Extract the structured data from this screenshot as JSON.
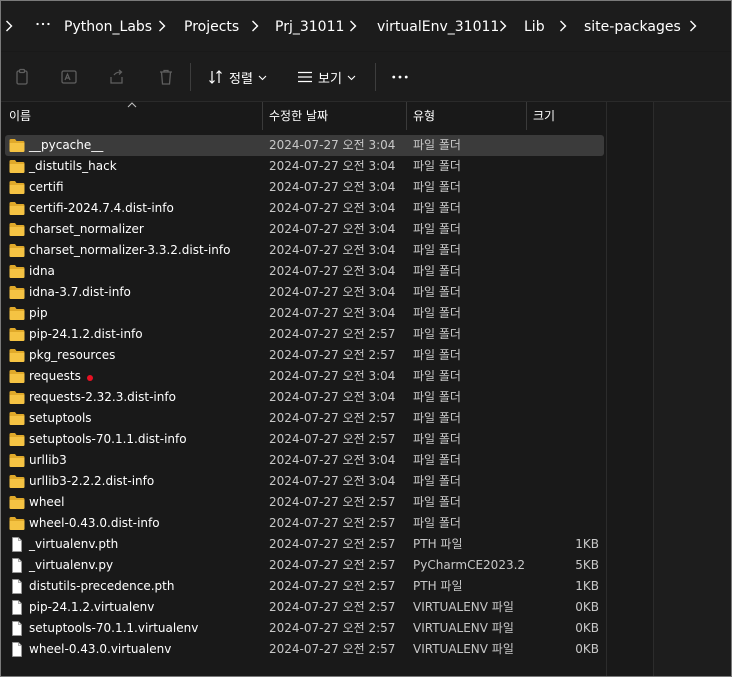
{
  "colors": {
    "folder": "#f5c343",
    "folder_dark": "#e0a92a",
    "selected_row": "#3b3b3b",
    "marker": "#e81123"
  },
  "breadcrumb": {
    "more_icon": "ellipsis-icon",
    "items": [
      "Python_Labs",
      "Projects",
      "Prj_31011",
      "virtualEnv_31011",
      "Lib",
      "site-packages"
    ]
  },
  "toolbar": {
    "icons": [
      "copy-icon",
      "rename-icon",
      "share-icon",
      "delete-icon"
    ],
    "sort_label": "정렬",
    "view_label": "보기",
    "more_icon": "more-icon"
  },
  "columns": {
    "name": "이름",
    "modified": "수정한 날짜",
    "type": "유형",
    "size": "크기"
  },
  "files": [
    {
      "name": "__pycache__",
      "date": "2024-07-27 오전 3:04",
      "type": "파일 폴더",
      "size": "",
      "kind": "folder",
      "selected": true
    },
    {
      "name": "_distutils_hack",
      "date": "2024-07-27 오전 3:04",
      "type": "파일 폴더",
      "size": "",
      "kind": "folder"
    },
    {
      "name": "certifi",
      "date": "2024-07-27 오전 3:04",
      "type": "파일 폴더",
      "size": "",
      "kind": "folder"
    },
    {
      "name": "certifi-2024.7.4.dist-info",
      "date": "2024-07-27 오전 3:04",
      "type": "파일 폴더",
      "size": "",
      "kind": "folder"
    },
    {
      "name": "charset_normalizer",
      "date": "2024-07-27 오전 3:04",
      "type": "파일 폴더",
      "size": "",
      "kind": "folder"
    },
    {
      "name": "charset_normalizer-3.3.2.dist-info",
      "date": "2024-07-27 오전 3:04",
      "type": "파일 폴더",
      "size": "",
      "kind": "folder"
    },
    {
      "name": "idna",
      "date": "2024-07-27 오전 3:04",
      "type": "파일 폴더",
      "size": "",
      "kind": "folder"
    },
    {
      "name": "idna-3.7.dist-info",
      "date": "2024-07-27 오전 3:04",
      "type": "파일 폴더",
      "size": "",
      "kind": "folder"
    },
    {
      "name": "pip",
      "date": "2024-07-27 오전 3:04",
      "type": "파일 폴더",
      "size": "",
      "kind": "folder"
    },
    {
      "name": "pip-24.1.2.dist-info",
      "date": "2024-07-27 오전 2:57",
      "type": "파일 폴더",
      "size": "",
      "kind": "folder"
    },
    {
      "name": "pkg_resources",
      "date": "2024-07-27 오전 2:57",
      "type": "파일 폴더",
      "size": "",
      "kind": "folder"
    },
    {
      "name": "requests",
      "date": "2024-07-27 오전 3:04",
      "type": "파일 폴더",
      "size": "",
      "kind": "folder",
      "marked": true
    },
    {
      "name": "requests-2.32.3.dist-info",
      "date": "2024-07-27 오전 3:04",
      "type": "파일 폴더",
      "size": "",
      "kind": "folder"
    },
    {
      "name": "setuptools",
      "date": "2024-07-27 오전 2:57",
      "type": "파일 폴더",
      "size": "",
      "kind": "folder"
    },
    {
      "name": "setuptools-70.1.1.dist-info",
      "date": "2024-07-27 오전 2:57",
      "type": "파일 폴더",
      "size": "",
      "kind": "folder"
    },
    {
      "name": "urllib3",
      "date": "2024-07-27 오전 3:04",
      "type": "파일 폴더",
      "size": "",
      "kind": "folder"
    },
    {
      "name": "urllib3-2.2.2.dist-info",
      "date": "2024-07-27 오전 3:04",
      "type": "파일 폴더",
      "size": "",
      "kind": "folder"
    },
    {
      "name": "wheel",
      "date": "2024-07-27 오전 2:57",
      "type": "파일 폴더",
      "size": "",
      "kind": "folder"
    },
    {
      "name": "wheel-0.43.0.dist-info",
      "date": "2024-07-27 오전 2:57",
      "type": "파일 폴더",
      "size": "",
      "kind": "folder"
    },
    {
      "name": "_virtualenv.pth",
      "date": "2024-07-27 오전 2:57",
      "type": "PTH 파일",
      "size": "1KB",
      "kind": "file"
    },
    {
      "name": "_virtualenv.py",
      "date": "2024-07-27 오전 2:57",
      "type": "PyCharmCE2023.2",
      "size": "5KB",
      "kind": "file"
    },
    {
      "name": "distutils-precedence.pth",
      "date": "2024-07-27 오전 2:57",
      "type": "PTH 파일",
      "size": "1KB",
      "kind": "file"
    },
    {
      "name": "pip-24.1.2.virtualenv",
      "date": "2024-07-27 오전 2:57",
      "type": "VIRTUALENV 파일",
      "size": "0KB",
      "kind": "file"
    },
    {
      "name": "setuptools-70.1.1.virtualenv",
      "date": "2024-07-27 오전 2:57",
      "type": "VIRTUALENV 파일",
      "size": "0KB",
      "kind": "file"
    },
    {
      "name": "wheel-0.43.0.virtualenv",
      "date": "2024-07-27 오전 2:57",
      "type": "VIRTUALENV 파일",
      "size": "0KB",
      "kind": "file"
    }
  ]
}
